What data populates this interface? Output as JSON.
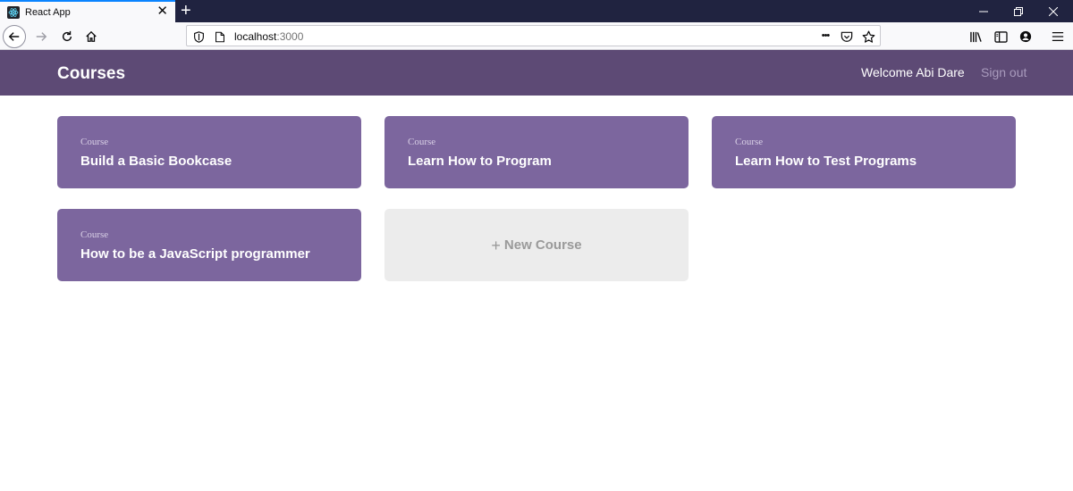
{
  "browser": {
    "tab_title": "React App",
    "url_host": "localhost",
    "url_port": ":3000",
    "url_more": "•••"
  },
  "header": {
    "title": "Courses",
    "welcome": "Welcome Abi Dare",
    "sign_out": "Sign out"
  },
  "courses": [
    {
      "label": "Course",
      "title": "Build a Basic Bookcase"
    },
    {
      "label": "Course",
      "title": "Learn How to Program"
    },
    {
      "label": "Course",
      "title": "Learn How to Test Programs"
    },
    {
      "label": "Course",
      "title": "How to be a JavaScript programmer"
    }
  ],
  "new_course": {
    "plus": "+",
    "label": "New Course"
  },
  "colors": {
    "header_bg": "#5d4a75",
    "card_bg": "#7c669e",
    "new_card_bg": "#ececec",
    "tabstrip_bg": "#202340"
  },
  "icons": {
    "tab_favicon": "react-icon",
    "close": "close-icon",
    "new_tab": "plus-icon",
    "back": "arrow-left-icon",
    "forward": "arrow-right-icon",
    "reload": "reload-icon",
    "home": "home-icon",
    "shield": "shield-icon",
    "page": "page-icon",
    "pocket": "pocket-icon",
    "bookmark": "star-icon",
    "library": "library-icon",
    "sidebar": "sidebar-icon",
    "account": "account-icon",
    "menu": "hamburger-menu-icon"
  }
}
